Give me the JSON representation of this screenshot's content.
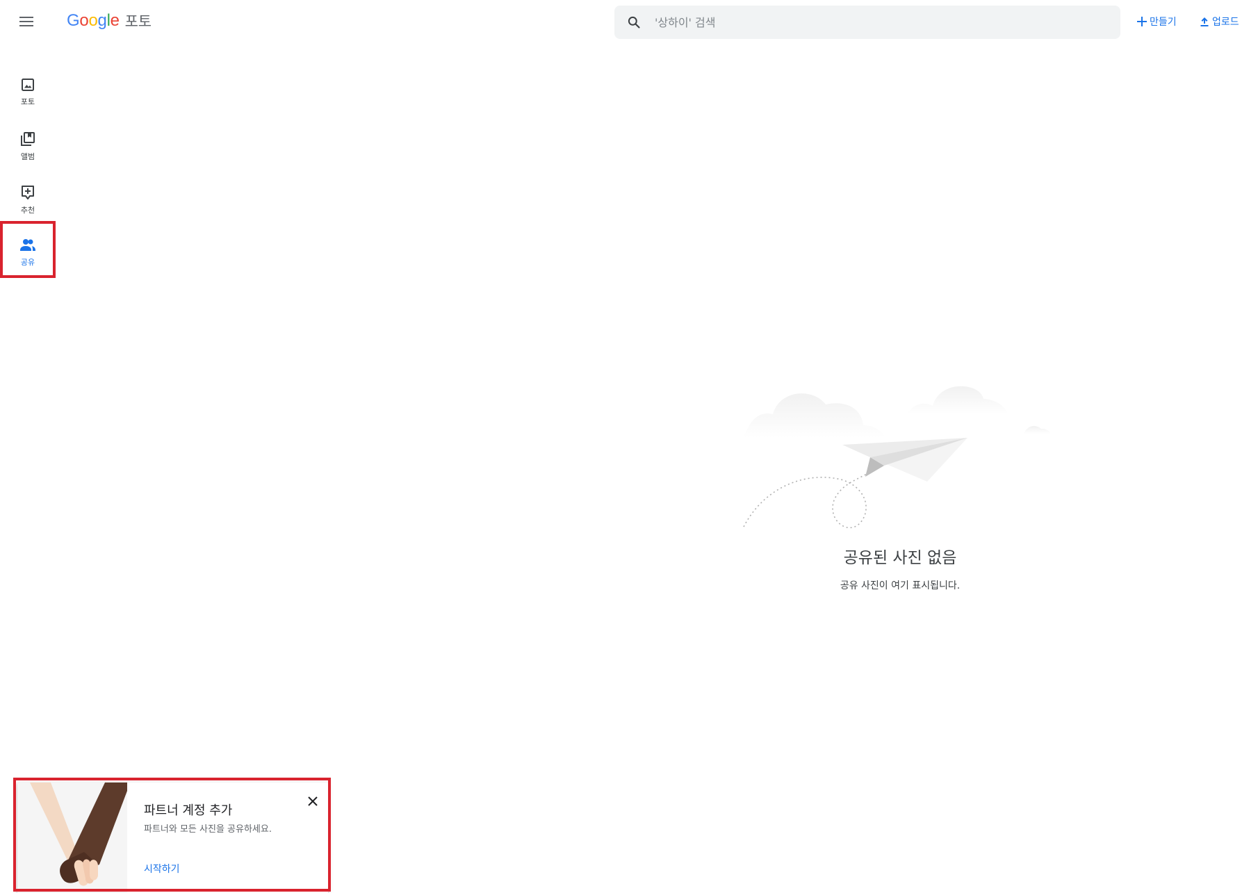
{
  "header": {
    "menu_icon": "hamburger-menu-icon",
    "logo_letters": [
      "G",
      "o",
      "o",
      "g",
      "l",
      "e"
    ],
    "product_name": "포토",
    "search": {
      "placeholder": "'상하이' 검색",
      "value": "",
      "icon": "search-icon"
    },
    "actions": [
      {
        "label": "만들기",
        "icon": "plus-icon"
      },
      {
        "label": "업로드",
        "icon": "upload-icon"
      }
    ]
  },
  "sidebar": {
    "items": [
      {
        "label": "포토",
        "icon": "photo-icon",
        "active": false
      },
      {
        "label": "앨범",
        "icon": "album-icon",
        "active": false
      },
      {
        "label": "추천",
        "icon": "suggestion-icon",
        "active": false
      },
      {
        "label": "공유",
        "icon": "people-icon",
        "active": true
      }
    ]
  },
  "empty_state": {
    "title": "공유된 사진 없음",
    "subtitle": "공유 사진이 여기 표시됩니다.",
    "illustration": "paper-plane-clouds-illustration"
  },
  "partner_card": {
    "title": "파트너 계정 추가",
    "description": "파트너와 모든 사진을 공유하세요.",
    "cta": "시작하기",
    "illustration": "holding-hands-illustration",
    "close_icon": "close-icon"
  },
  "colors": {
    "accent": "#1a73e8",
    "highlight": "#d9232e",
    "search_bg": "#f1f3f4"
  }
}
